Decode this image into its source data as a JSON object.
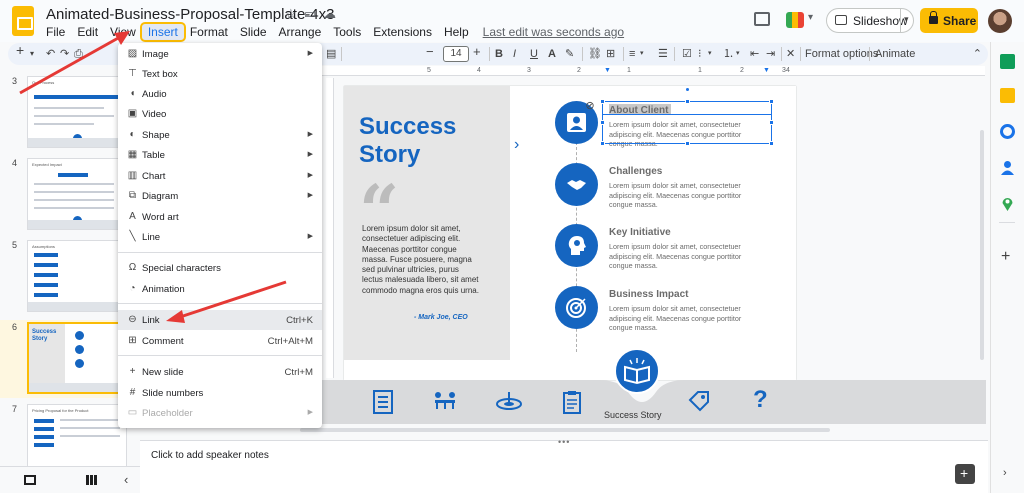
{
  "window": {
    "doc_title": "Animated-Business-Proposal-Template-4x3",
    "last_edit": "Last edit was seconds ago"
  },
  "menubar": [
    "File",
    "Edit",
    "View",
    "Insert",
    "Format",
    "Slide",
    "Arrange",
    "Tools",
    "Extensions",
    "Help"
  ],
  "header": {
    "slideshow_label": "Slideshow",
    "share_label": "Share"
  },
  "toolbar": {
    "font_size": "14",
    "format_options": "Format options",
    "animate": "Animate"
  },
  "ruler": [
    "5",
    "4",
    "3",
    "2",
    "1",
    "1",
    "2",
    "3",
    "4"
  ],
  "filmstrip": {
    "slide_numbers": [
      "3",
      "4",
      "5",
      "6",
      "7"
    ],
    "selected": "6",
    "thumb_titles": [
      "Our Process",
      "Expected Impact",
      "Assumptions",
      "Success Story",
      "Pricing Proposal for the Product"
    ]
  },
  "insert_menu": {
    "items": [
      {
        "label": "Image",
        "icon": "image-icon",
        "submenu": true
      },
      {
        "label": "Text box",
        "icon": "text-box-icon"
      },
      {
        "label": "Audio",
        "icon": "audio-icon"
      },
      {
        "label": "Video",
        "icon": "video-icon"
      },
      {
        "label": "Shape",
        "icon": "shape-icon",
        "submenu": true
      },
      {
        "label": "Table",
        "icon": "table-icon",
        "submenu": true
      },
      {
        "label": "Chart",
        "icon": "chart-icon",
        "submenu": true
      },
      {
        "label": "Diagram",
        "icon": "diagram-icon",
        "submenu": true
      },
      {
        "label": "Word art",
        "icon": "word-art-icon"
      },
      {
        "label": "Line",
        "icon": "line-icon",
        "submenu": true
      },
      {
        "label": "Special characters",
        "icon": "omega-icon"
      },
      {
        "label": "Animation",
        "icon": "animation-icon"
      },
      {
        "label": "Link",
        "icon": "link-icon",
        "shortcut": "Ctrl+K"
      },
      {
        "label": "Comment",
        "icon": "comment-icon",
        "shortcut": "Ctrl+Alt+M"
      },
      {
        "label": "New slide",
        "icon": "plus-icon",
        "shortcut": "Ctrl+M"
      },
      {
        "label": "Slide numbers",
        "icon": "hash-icon"
      },
      {
        "label": "Placeholder",
        "icon": "placeholder-icon",
        "submenu": true,
        "disabled": true
      }
    ]
  },
  "slide": {
    "title": "Success Story",
    "quote_text": "Lorem ipsum dolor sit amet, consectetuer adipiscing elit. Maecenas porttitor congue massa. Fusce posuere, magna sed pulvinar ultricies, purus lectus malesuada libero, sit amet commodo magna eros quis urna.",
    "quote_author": "- Mark Joe, CEO",
    "timeline": [
      {
        "title": "About Client",
        "text": "Lorem ipsum dolor sit amet, consectetuer adipiscing elit. Maecenas congue porttitor congue massa.",
        "icon": "user-icon"
      },
      {
        "title": "Challenges",
        "text": "Lorem ipsum dolor sit amet, consectetuer adipiscing elit. Maecenas congue porttitor congue massa.",
        "icon": "handshake-icon"
      },
      {
        "title": "Key Initiative",
        "text": "Lorem ipsum dolor sit amet, consectetuer adipiscing elit. Maecenas congue porttitor congue massa.",
        "icon": "head-bulb-icon"
      },
      {
        "title": "Business Impact",
        "text": "Lorem ipsum dolor sit amet, consectetuer adipiscing elit. Maecenas congue porttitor congue massa.",
        "icon": "target-icon"
      }
    ],
    "footer_label": "Success Story"
  },
  "speaker_notes": {
    "placeholder": "Click to add speaker notes"
  },
  "colors": {
    "accent": "#1565c0",
    "brand": "#fbbc04",
    "annotation_arrow": "#e53935"
  }
}
